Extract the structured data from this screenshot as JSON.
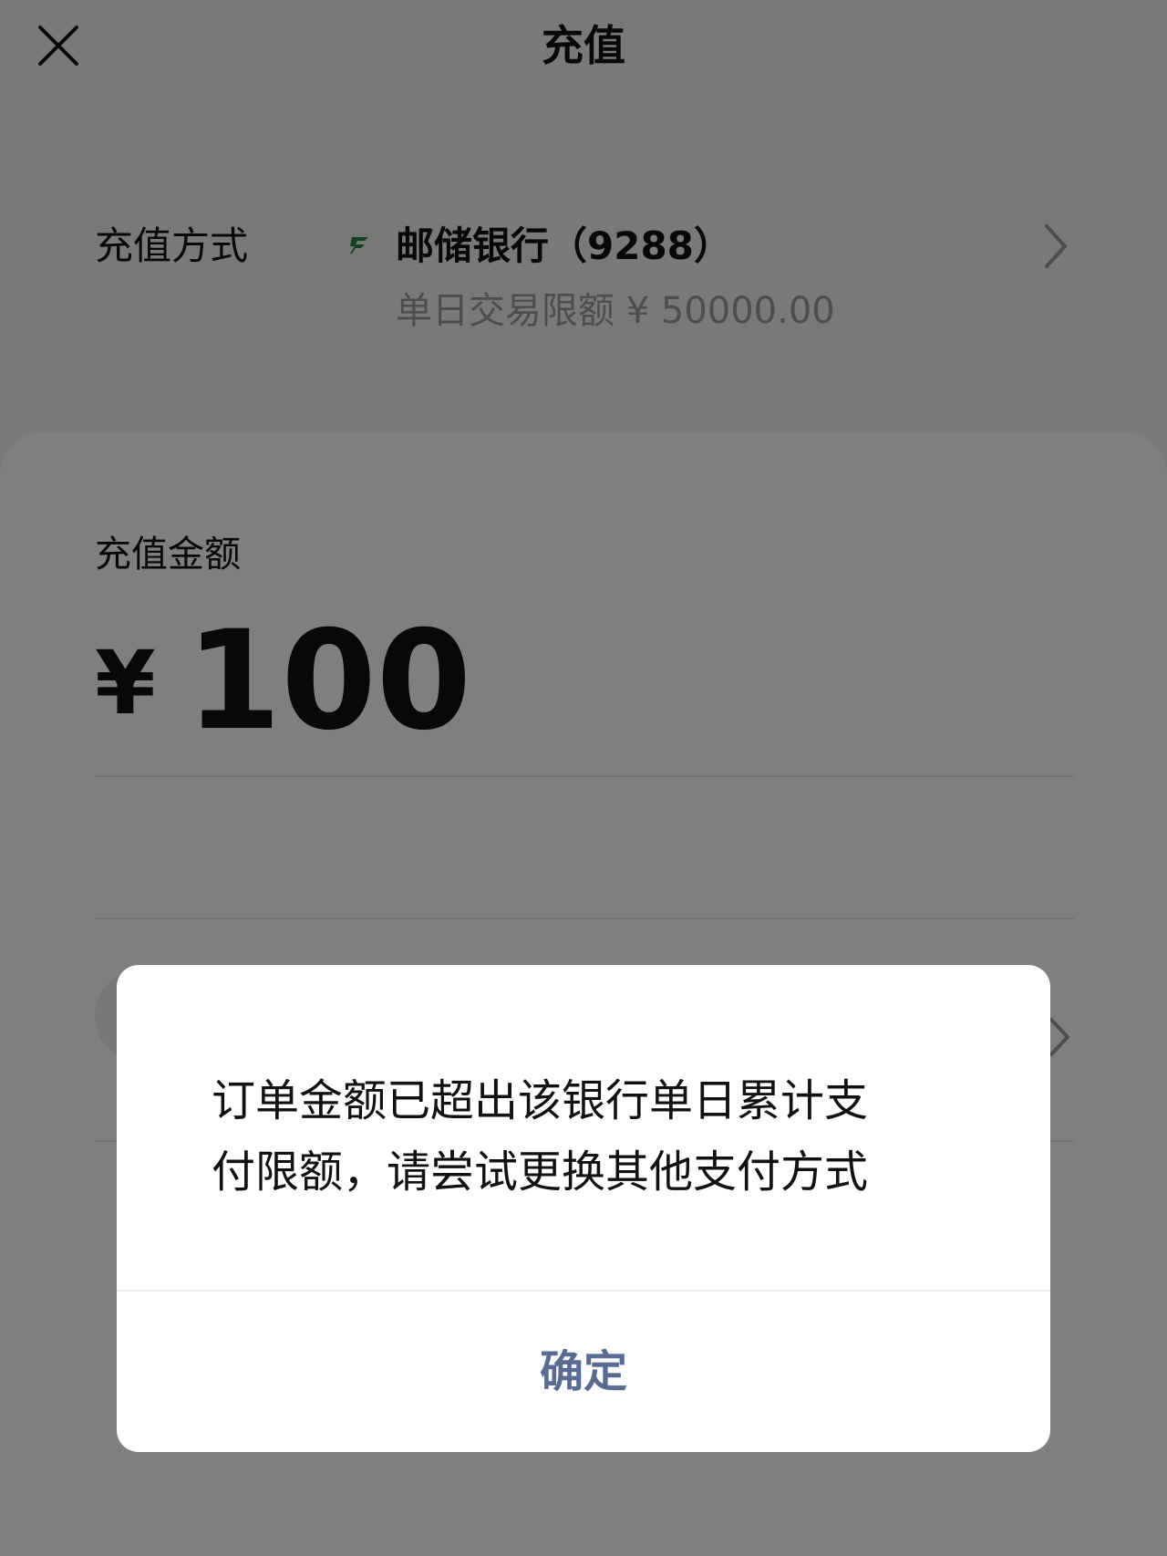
{
  "header": {
    "title": "充值",
    "close_icon": "close-icon"
  },
  "payment_method": {
    "label": "充值方式",
    "bank_icon": "postal-savings-bank-logo",
    "bank_name": "邮储银行（9288）",
    "limit_text": "单日交易限额 ¥ 50000.00"
  },
  "amount": {
    "label": "充值金额",
    "currency": "¥",
    "value": "100"
  },
  "dialog": {
    "message_line1": "订单金额已超出该银行单日累计支",
    "message_line2": "付限额，请尝试更换其他支付方式",
    "confirm_label": "确定",
    "accent_color": "#576b95"
  }
}
